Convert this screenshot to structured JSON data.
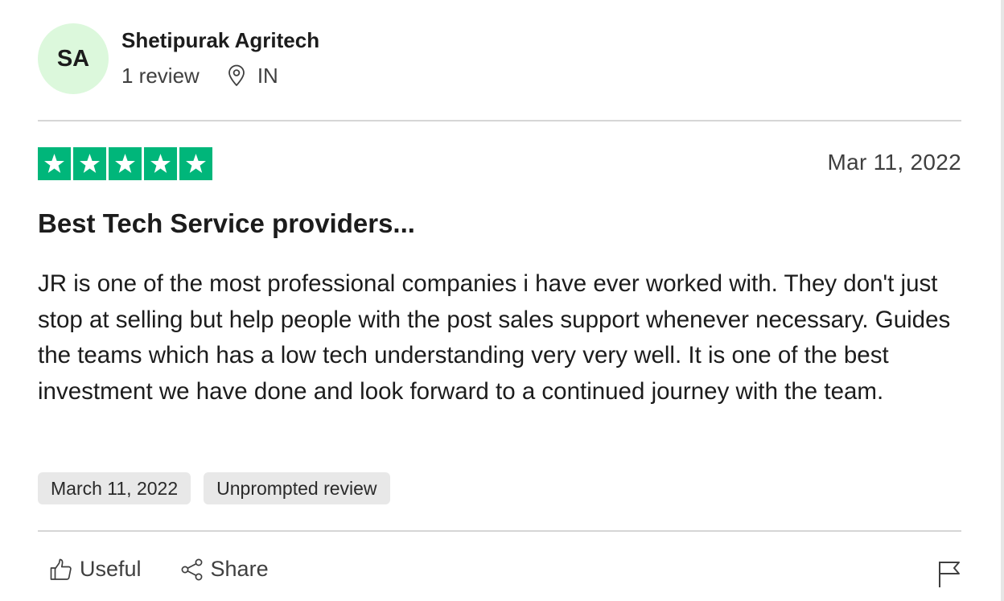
{
  "reviewer": {
    "initials": "SA",
    "name": "Shetipurak Agritech",
    "review_count": "1 review",
    "location": "IN"
  },
  "review": {
    "rating": 5,
    "date_short": "Mar 11, 2022",
    "title": "Best Tech Service providers...",
    "body": "JR is one of the most professional companies i have ever worked with. They don't just stop at selling but help people with the post sales support whenever necessary. Guides the teams which has a low tech understanding very very well. It is one of the best investment we have done and look forward to a continued journey with the team.",
    "tags": {
      "date_of_experience": "March 11, 2022",
      "type": "Unprompted review"
    }
  },
  "actions": {
    "useful_label": "Useful",
    "share_label": "Share"
  },
  "colors": {
    "star_green": "#00b67a",
    "avatar_bg": "#dcf8dc",
    "tag_bg": "#e8e8e8"
  },
  "icons": [
    "location-pin-icon",
    "star-icon",
    "thumbs-up-icon",
    "share-icon",
    "flag-icon"
  ]
}
